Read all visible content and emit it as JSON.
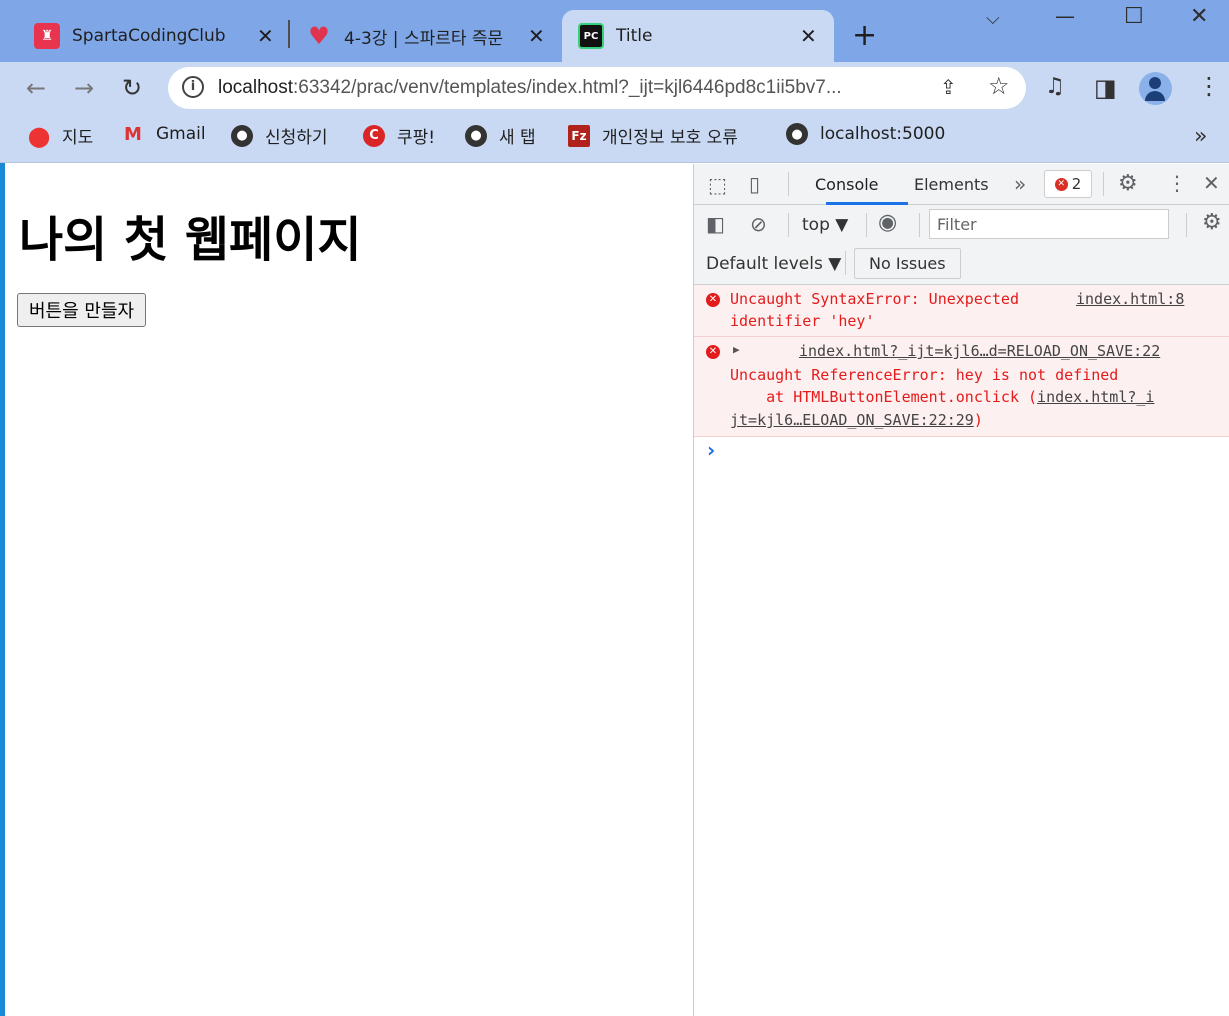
{
  "browser": {
    "tabs": [
      {
        "title": "SpartaCodingClub",
        "icon": "sparta-icon"
      },
      {
        "title": "4-3강 | 스파르타 즉문",
        "icon": "code-heart-icon"
      },
      {
        "title": "Title",
        "icon": "pycharm-icon"
      }
    ],
    "favicon_text": {
      "sparta": "♜",
      "pycharm": "PC"
    },
    "url_host": "localhost",
    "url_rest": ":63342/prac/venv/templates/index.html?_ijt=kjl6446pd8c1ii5bv7...",
    "bookmarks": [
      {
        "label": "지도",
        "icon": "maps-icon"
      },
      {
        "label": "Gmail",
        "icon": "gmail-icon"
      },
      {
        "label": "신청하기",
        "icon": "globe-icon"
      },
      {
        "label": "쿠팡!",
        "icon": "coupang-icon"
      },
      {
        "label": "새 탭",
        "icon": "globe-icon"
      },
      {
        "label": "개인정보 보호 오류",
        "icon": "filezilla-icon"
      },
      {
        "label": "localhost:5000",
        "icon": "globe-icon"
      }
    ],
    "bookmark_glyphs": {
      "coupang": "C",
      "filezilla": "Fz",
      "globe": "●",
      "gmail": "M"
    }
  },
  "page": {
    "heading": "나의 첫 웹페이지",
    "button_label": "버튼을 만들자"
  },
  "devtools": {
    "tabs": [
      "Console",
      "Elements"
    ],
    "active_tab": "Console",
    "error_count": "2",
    "context": "top ▼",
    "filter_placeholder": "Filter",
    "levels": "Default levels ▼",
    "issues": "No Issues",
    "messages": [
      {
        "line1": "Uncaught SyntaxError: Unexpected",
        "line2": "identifier 'hey'",
        "source": "index.html:8"
      },
      {
        "source": "index.html?_ijt=kjl6…d=RELOAD_ON_SAVE:22",
        "line1": "Uncaught ReferenceError: hey is not defined",
        "line2_prefix": "    at HTMLButtonElement.onclick (",
        "line2_link": "index.html?_i",
        "line3_link": "jt=kjl6…ELOAD_ON_SAVE:22:29",
        "line3_suffix": ")"
      }
    ],
    "prompt": "›"
  },
  "colors": {
    "tab_strip": "#7fa7e8",
    "toolbar": "#c9d9f3",
    "error_red": "#e41b1b",
    "error_bg": "#fdf0f0",
    "active_tab_underline": "#1a73e8"
  }
}
